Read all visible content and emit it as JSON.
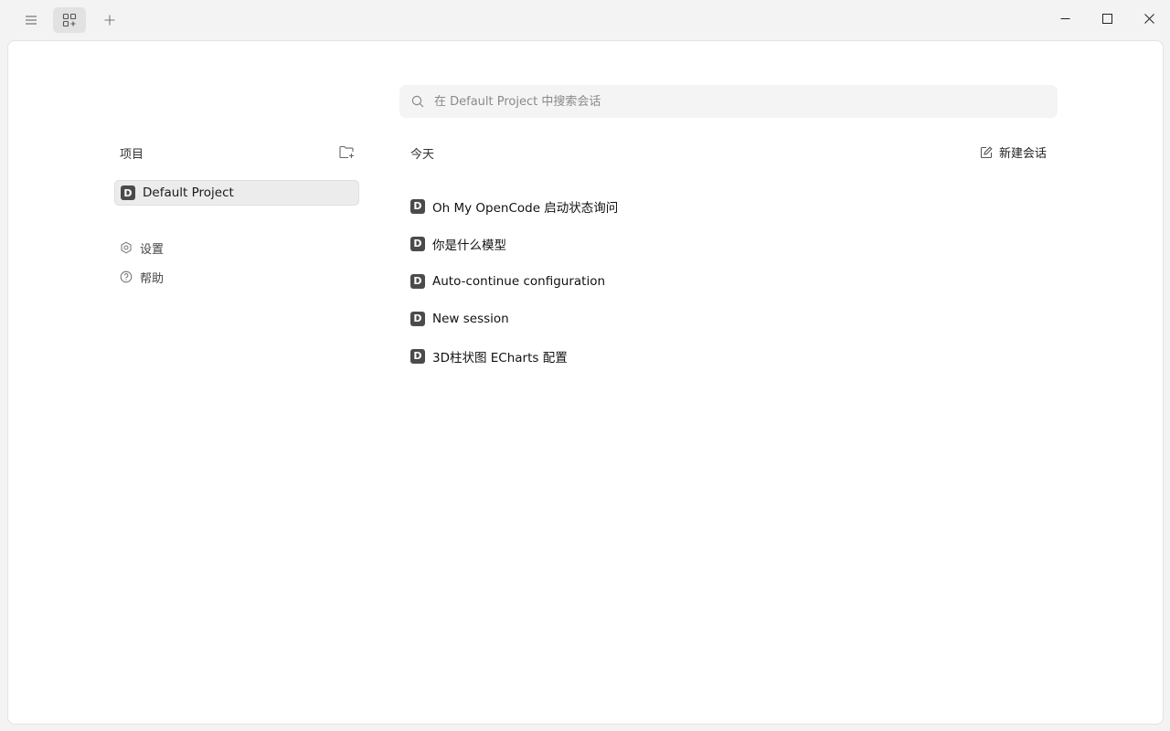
{
  "titlebar": {
    "menu_icon": "hamburger-icon",
    "apps_icon": "grid-plus-icon",
    "add_icon": "plus-icon",
    "window_controls": [
      "minimize-icon",
      "maximize-icon",
      "close-icon"
    ]
  },
  "search": {
    "placeholder": "在 Default Project 中搜索会话",
    "value": ""
  },
  "sidebar": {
    "projects_header": "项目",
    "projects": [
      {
        "badge": "D",
        "label": "Default Project",
        "selected": true
      }
    ],
    "links": [
      {
        "label": "设置",
        "icon": "gear-icon"
      },
      {
        "label": "帮助",
        "icon": "help-circle-icon"
      }
    ]
  },
  "main": {
    "group_label": "今天",
    "new_session_label": "新建会话",
    "sessions": [
      {
        "badge": "D",
        "label": "Oh My OpenCode 启动状态询问"
      },
      {
        "badge": "D",
        "label": "你是什么模型"
      },
      {
        "badge": "D",
        "label": "Auto-continue configuration"
      },
      {
        "badge": "D",
        "label": "New session"
      },
      {
        "badge": "D",
        "label": "3D柱状图 ECharts 配置"
      }
    ]
  },
  "colors": {
    "window_bg": "#f3f3f3",
    "panel_bg": "#ffffff",
    "badge_bg": "#4b4b4b",
    "selected_bg": "#ececec"
  }
}
